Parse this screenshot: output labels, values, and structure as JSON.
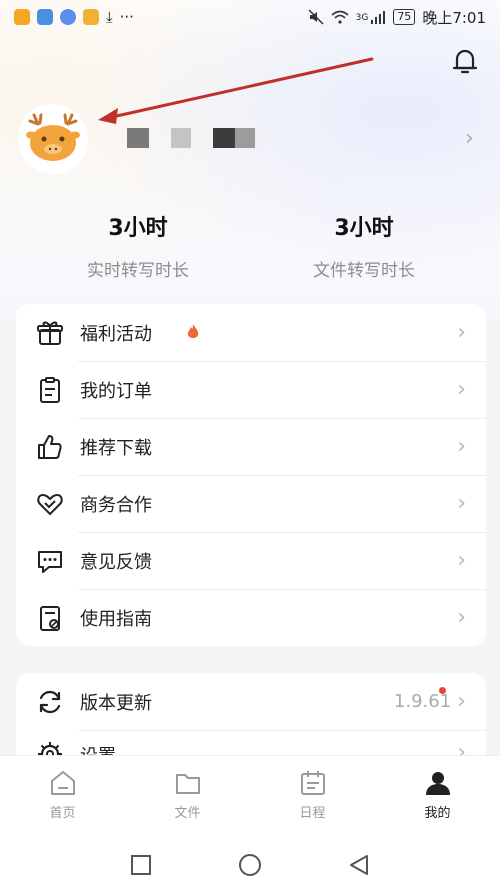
{
  "status_bar": {
    "app_icon_colors": [
      "#f5a623",
      "#4a90e2",
      "#5b8def",
      "#f2b135"
    ],
    "download_glyph": "⤓",
    "more_glyph": "···",
    "network": "3G",
    "battery": "75",
    "time": "晚上7:01"
  },
  "header": {
    "avatar_icon": "deer-face-avatar",
    "name_pixel_colors": [
      "#7a7a7a",
      "#c4c4c4",
      "#3c3c3c",
      "#9c9c9c"
    ],
    "chevron": "›"
  },
  "stats": [
    {
      "value": "3小时",
      "label": "实时转写时长"
    },
    {
      "value": "3小时",
      "label": "文件转写时长"
    }
  ],
  "menu": [
    {
      "label": "福利活动",
      "icon": "gift-icon",
      "fire": true
    },
    {
      "label": "我的订单",
      "icon": "order-clipboard-icon"
    },
    {
      "label": "推荐下载",
      "icon": "thumbs-up-icon"
    },
    {
      "label": "商务合作",
      "icon": "handshake-heart-icon"
    },
    {
      "label": "意见反馈",
      "icon": "chat-bubble-icon"
    },
    {
      "label": "使用指南",
      "icon": "guide-book-icon"
    }
  ],
  "settings": [
    {
      "label": "版本更新",
      "icon": "refresh-icon",
      "value": "1.9.61"
    },
    {
      "label": "设置",
      "icon": "gear-icon"
    }
  ],
  "tabs": [
    {
      "label": "首页",
      "icon": "home-icon"
    },
    {
      "label": "文件",
      "icon": "folder-icon"
    },
    {
      "label": "日程",
      "icon": "calendar-icon"
    },
    {
      "label": "我的",
      "icon": "person-icon",
      "active": true
    }
  ],
  "colors": {
    "accent": "#e8473b",
    "annotation_arrow": "#c0302a"
  }
}
